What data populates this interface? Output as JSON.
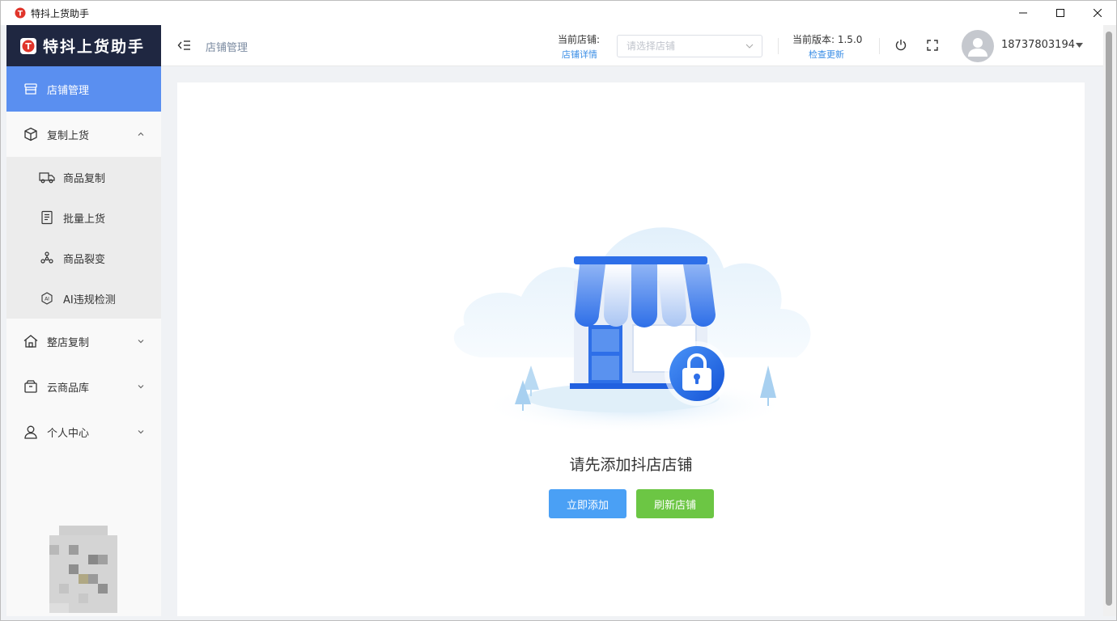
{
  "window": {
    "title": "特抖上货助手"
  },
  "sidebar": {
    "brand": "特抖上货助手",
    "items": [
      {
        "label": "店铺管理",
        "icon": "store-icon",
        "active": true
      },
      {
        "label": "复制上货",
        "icon": "box-icon",
        "expanded": true,
        "children": [
          {
            "label": "商品复制",
            "icon": "truck-icon"
          },
          {
            "label": "批量上货",
            "icon": "document-list-icon"
          },
          {
            "label": "商品裂变",
            "icon": "network-icon"
          },
          {
            "label": "AI违规检测",
            "icon": "ai-icon"
          }
        ]
      },
      {
        "label": "整店复制",
        "icon": "home-icon"
      },
      {
        "label": "云商品库",
        "icon": "package-icon"
      },
      {
        "label": "个人中心",
        "icon": "user-icon"
      }
    ]
  },
  "header": {
    "breadcrumb": "店铺管理",
    "store_label": "当前店铺:",
    "store_detail_link": "店铺详情",
    "store_select_placeholder": "请选择店铺",
    "version_label": "当前版本: 1.5.0",
    "version_update_link": "检查更新",
    "username": "18737803194"
  },
  "main": {
    "empty_message": "请先添加抖店店铺",
    "add_button": "立即添加",
    "refresh_button": "刷新店铺"
  },
  "colors": {
    "brand_dark": "#1f2741",
    "active_nav": "#5a8ff0",
    "link": "#3a8ee6",
    "primary_button": "#4aa0f5",
    "success_button": "#6cc644"
  }
}
